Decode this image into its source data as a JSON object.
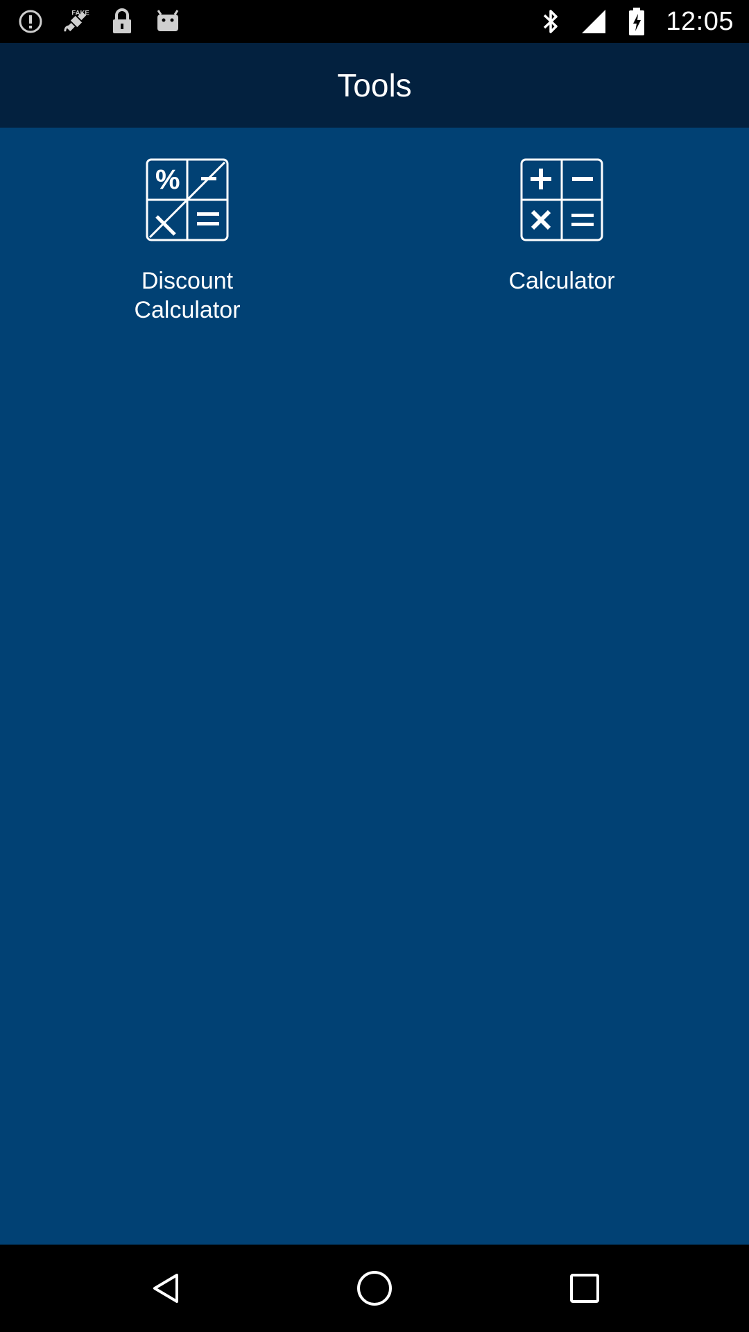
{
  "status_bar": {
    "time": "12:05",
    "left_icons": [
      "alert-circle-icon",
      "fake-gps-icon",
      "lock-icon",
      "android-icon"
    ],
    "right_icons": [
      "bluetooth-icon",
      "signal-icon",
      "battery-icon"
    ]
  },
  "app_bar": {
    "title": "Tools"
  },
  "tools": [
    {
      "label": "Discount\nCalculator",
      "icon": "discount-calculator-icon"
    },
    {
      "label": "Calculator",
      "icon": "calculator-icon"
    }
  ],
  "nav_bar": {
    "buttons": [
      "back-icon",
      "home-icon",
      "recents-icon"
    ]
  },
  "colors": {
    "app_bar_bg": "#03213f",
    "content_bg": "#014174",
    "system_bar_bg": "#000000",
    "foreground": "#ffffff"
  }
}
